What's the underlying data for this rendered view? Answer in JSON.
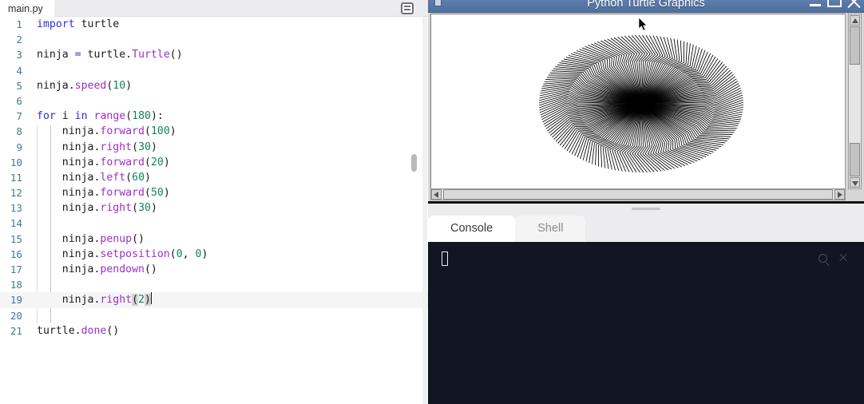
{
  "editor": {
    "tab_label": "main.py",
    "menu_icon": "list-menu-icon",
    "lines": [
      {
        "n": "1",
        "tokens": [
          {
            "t": "import",
            "c": "kw"
          },
          {
            "t": " turtle",
            "c": "plain"
          }
        ]
      },
      {
        "n": "2",
        "tokens": []
      },
      {
        "n": "3",
        "tokens": [
          {
            "t": "ninja ",
            "c": "plain"
          },
          {
            "t": "=",
            "c": "op"
          },
          {
            "t": " turtle.",
            "c": "plain"
          },
          {
            "t": "Turtle",
            "c": "cls"
          },
          {
            "t": "()",
            "c": "paren"
          }
        ]
      },
      {
        "n": "4",
        "tokens": []
      },
      {
        "n": "5",
        "tokens": [
          {
            "t": "ninja.",
            "c": "plain"
          },
          {
            "t": "speed",
            "c": "fn"
          },
          {
            "t": "(",
            "c": "paren"
          },
          {
            "t": "10",
            "c": "num"
          },
          {
            "t": ")",
            "c": "paren"
          }
        ]
      },
      {
        "n": "6",
        "tokens": []
      },
      {
        "n": "7",
        "tokens": [
          {
            "t": "for",
            "c": "kw"
          },
          {
            "t": " i ",
            "c": "plain"
          },
          {
            "t": "in",
            "c": "kw"
          },
          {
            "t": " ",
            "c": "plain"
          },
          {
            "t": "range",
            "c": "cls"
          },
          {
            "t": "(",
            "c": "paren"
          },
          {
            "t": "180",
            "c": "num"
          },
          {
            "t": "):",
            "c": "paren"
          }
        ]
      },
      {
        "n": "8",
        "tokens": [
          {
            "t": "    ninja.",
            "c": "plain"
          },
          {
            "t": "forward",
            "c": "fn"
          },
          {
            "t": "(",
            "c": "paren"
          },
          {
            "t": "100",
            "c": "num"
          },
          {
            "t": ")",
            "c": "paren"
          }
        ]
      },
      {
        "n": "9",
        "tokens": [
          {
            "t": "    ninja.",
            "c": "plain"
          },
          {
            "t": "right",
            "c": "fn"
          },
          {
            "t": "(",
            "c": "paren"
          },
          {
            "t": "30",
            "c": "num"
          },
          {
            "t": ")",
            "c": "paren"
          }
        ]
      },
      {
        "n": "10",
        "tokens": [
          {
            "t": "    ninja.",
            "c": "plain"
          },
          {
            "t": "forward",
            "c": "fn"
          },
          {
            "t": "(",
            "c": "paren"
          },
          {
            "t": "20",
            "c": "num"
          },
          {
            "t": ")",
            "c": "paren"
          }
        ]
      },
      {
        "n": "11",
        "tokens": [
          {
            "t": "    ninja.",
            "c": "plain"
          },
          {
            "t": "left",
            "c": "fn"
          },
          {
            "t": "(",
            "c": "paren"
          },
          {
            "t": "60",
            "c": "num"
          },
          {
            "t": ")",
            "c": "paren"
          }
        ]
      },
      {
        "n": "12",
        "tokens": [
          {
            "t": "    ninja.",
            "c": "plain"
          },
          {
            "t": "forward",
            "c": "fn"
          },
          {
            "t": "(",
            "c": "paren"
          },
          {
            "t": "50",
            "c": "num"
          },
          {
            "t": ")",
            "c": "paren"
          }
        ]
      },
      {
        "n": "13",
        "tokens": [
          {
            "t": "    ninja.",
            "c": "plain"
          },
          {
            "t": "right",
            "c": "fn"
          },
          {
            "t": "(",
            "c": "paren"
          },
          {
            "t": "30",
            "c": "num"
          },
          {
            "t": ")",
            "c": "paren"
          }
        ]
      },
      {
        "n": "14",
        "tokens": []
      },
      {
        "n": "15",
        "tokens": [
          {
            "t": "    ninja.",
            "c": "plain"
          },
          {
            "t": "penup",
            "c": "fn"
          },
          {
            "t": "()",
            "c": "paren"
          }
        ]
      },
      {
        "n": "16",
        "tokens": [
          {
            "t": "    ninja.",
            "c": "plain"
          },
          {
            "t": "setposition",
            "c": "fn"
          },
          {
            "t": "(",
            "c": "paren"
          },
          {
            "t": "0",
            "c": "num"
          },
          {
            "t": ", ",
            "c": "plain"
          },
          {
            "t": "0",
            "c": "num"
          },
          {
            "t": ")",
            "c": "paren"
          }
        ]
      },
      {
        "n": "17",
        "tokens": [
          {
            "t": "    ninja.",
            "c": "plain"
          },
          {
            "t": "pendown",
            "c": "fn"
          },
          {
            "t": "()",
            "c": "paren"
          }
        ]
      },
      {
        "n": "18",
        "tokens": []
      },
      {
        "n": "19",
        "active": true,
        "tokens": [
          {
            "t": "    ninja.",
            "c": "plain"
          },
          {
            "t": "right",
            "c": "fn"
          },
          {
            "t": "(",
            "c": "match"
          },
          {
            "t": "2",
            "c": "num"
          },
          {
            "t": ")",
            "c": "match"
          }
        ]
      },
      {
        "n": "20",
        "tokens": []
      },
      {
        "n": "21",
        "tokens": [
          {
            "t": "turtle.",
            "c": "plain"
          },
          {
            "t": "done",
            "c": "fn"
          },
          {
            "t": "()",
            "c": "paren"
          }
        ]
      }
    ]
  },
  "turtle_window": {
    "title": "Python Turtle Graphics",
    "minimize_label": "—",
    "maximize_label": "□",
    "close_label": "✕",
    "canvas_description": "dense black radial starburst spirograph pattern"
  },
  "console": {
    "tabs": [
      {
        "label": "Console",
        "active": true
      },
      {
        "label": "Shell",
        "active": false
      }
    ],
    "search_icon": "search-icon",
    "close_icon": "close-icon",
    "output": ""
  },
  "colors": {
    "titlebar": "#5a7aa8",
    "console_bg": "#111524",
    "keyword": "#2b2ee0",
    "function": "#9b30c7",
    "number": "#11835f",
    "linenumber": "#3e7a96"
  }
}
